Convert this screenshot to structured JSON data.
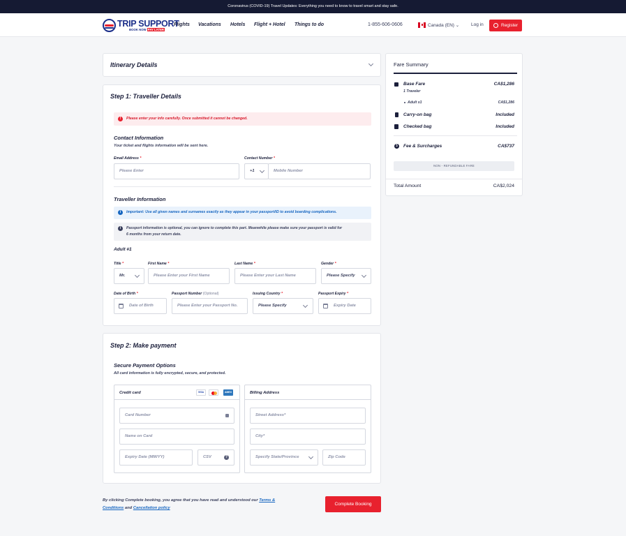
{
  "banner": {
    "text": "Coronavirus (COVID-19) Travel Updates: Everything you need to know to travel smart and stay safe."
  },
  "logo": {
    "name": "TRIP SUPPORT",
    "tagline_prefix": "BOOK NOW",
    "tagline_highlight": "PAY LATER"
  },
  "nav": {
    "menu": [
      "Flights",
      "Vacations",
      "Hotels",
      "Flight + Hotel",
      "Things to do"
    ],
    "phone": "1-855-606-0606",
    "locale": "Canada (EN)",
    "login": "Log in",
    "register": "Register"
  },
  "itinerary": {
    "title": "Itinerary Details"
  },
  "step1": {
    "title": "Step 1:  Traveller Details",
    "warning": "Please enter your info carefully. Once submitted it cannot be changed.",
    "contact": {
      "title": "Contact Information",
      "note": "Your ticket and flights information will be sent here.",
      "email_label": "Email Address",
      "email_placeholder": "Please Enter",
      "phone_label": "Contact Number",
      "phone_code": "+1",
      "phone_placeholder": "Mobile Number"
    },
    "traveller": {
      "title": "Traveller Information",
      "important": "Important: Use all given names and surnames exactly as they appear in your passport/ID to avoid boarding complications.",
      "passport_note_1": "Passport information is optional, you can ignore to complete this part. Meanwhile please make sure your passport is valid for",
      "passport_note_2": "6 months from your return date.",
      "adult": "Adult #1",
      "title_label": "Title",
      "title_value": "Mr.",
      "first_label": "First Name",
      "first_placeholder": "Please Enter your First Name",
      "last_label": "Last Name",
      "last_placeholder": "Please Enter your Last Name",
      "gender_label": "Gender",
      "gender_value": "Please Specify",
      "dob_label": "Date of Birth",
      "dob_placeholder": "Date of Birth",
      "passport_label": "Passport Number",
      "passport_optional": "(Optional)",
      "passport_placeholder": "Please Enter your Passport No.",
      "country_label": "Issuing Country",
      "country_value": "Please Specify",
      "expiry_label": "Passport Expiry",
      "expiry_placeholder": "Expiry Date",
      "required_mark": "*"
    }
  },
  "step2": {
    "title": "Step 2:  Make payment",
    "secure_title": "Secure Payment Options",
    "secure_note": "All card information is fully encrypted, secure, and protected.",
    "credit_card": "Credit card",
    "card_brands": [
      "VISA",
      "MC",
      "AMEX"
    ],
    "card_number": "Card Number",
    "name_on_card": "Name on Card",
    "expiry": "Expiry Date (MM/YY)",
    "csv": "CSV",
    "billing_title": "Billing Address",
    "street": "Street Address*",
    "city": "City*",
    "state": "Specify State/Province",
    "zip": "Zip Code"
  },
  "footer": {
    "agree_1": "By clicking Complete booking, you agree that you have read and understood our",
    "terms": "Terms &",
    "terms_2": "Conditions",
    "and": "and",
    "cancellation": "Cancellation policy",
    "complete": "Complete Booking"
  },
  "fare": {
    "title": "Fare Summary",
    "base_fare": "Base Fare",
    "base_fare_value": "CA$1,286",
    "travelers": "1 Traveler",
    "adult": "Adult x1",
    "adult_value": "CA$1,286",
    "carry_on": "Carry-on bag",
    "carry_on_value": "Included",
    "checked": "Checked bag",
    "checked_value": "Included",
    "fees": "Fee & Surcharges",
    "fees_value": "CA$737",
    "non_refundable": "NON - REFUNDABLE FARE",
    "total_label": "Total Amount",
    "total_value": "CA$2,024"
  },
  "colors": {
    "accent": "#e8212e",
    "navy": "#151a33",
    "brand_blue": "#1c2f8a"
  }
}
